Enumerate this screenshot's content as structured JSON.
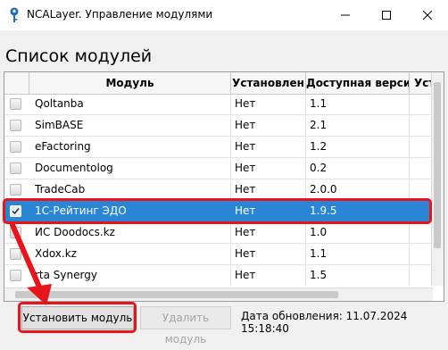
{
  "window": {
    "title": "NCALayer. Управление модулями"
  },
  "heading": "Список модулей",
  "table": {
    "columns": [
      "",
      "Модуль",
      "Установлен",
      "Доступная версия",
      "Устан"
    ],
    "rows": [
      {
        "name": "Qoltanba",
        "installed": "Нет",
        "version": "1.1",
        "checked": false,
        "selected": false
      },
      {
        "name": "SimBASE",
        "installed": "Нет",
        "version": "2.1",
        "checked": false,
        "selected": false
      },
      {
        "name": "eFactoring",
        "installed": "Нет",
        "version": "1.2",
        "checked": false,
        "selected": false
      },
      {
        "name": "Documentolog",
        "installed": "Нет",
        "version": "0.2",
        "checked": false,
        "selected": false
      },
      {
        "name": "TradeCab",
        "installed": "Нет",
        "version": "2.0.0",
        "checked": false,
        "selected": false
      },
      {
        "name": "1С-Рейтинг ЭДО",
        "installed": "Нет",
        "version": "1.9.5",
        "checked": true,
        "selected": true
      },
      {
        "name": "ИС Doodocs.kz",
        "installed": "Нет",
        "version": "1.0",
        "checked": false,
        "selected": false
      },
      {
        "name": "Xdox.kz",
        "installed": "Нет",
        "version": "1.1",
        "checked": false,
        "selected": false
      },
      {
        "name": "rta Synergy",
        "installed": "Нет",
        "version": "1.5",
        "checked": false,
        "selected": false
      }
    ]
  },
  "buttons": {
    "install": "Установить модуль",
    "remove": "Удалить модуль"
  },
  "update_date": "Дата обновления: 11.07.2024 15:18:40",
  "colors": {
    "selection": "#2a86d4",
    "highlight": "#e8141b"
  }
}
